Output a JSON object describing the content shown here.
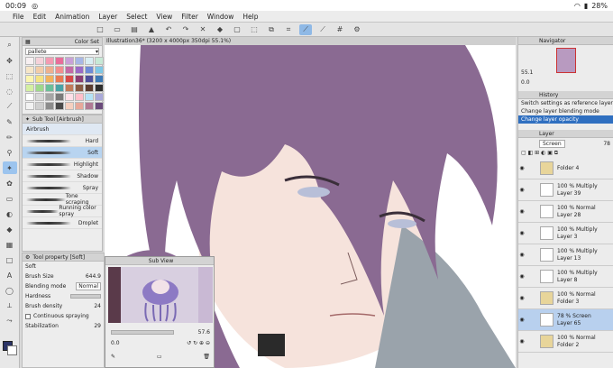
{
  "status": {
    "time": "00:09",
    "battery": "28%"
  },
  "menu": [
    "File",
    "Edit",
    "Animation",
    "Layer",
    "Select",
    "View",
    "Filter",
    "Window",
    "Help"
  ],
  "canvas_title": "Illustration36* (3200 x 4000px 350dpi 55.1%)",
  "color_set": {
    "title": "Color Set",
    "palette": "pallete",
    "colors": [
      "#f7f0f2",
      "#f5d2da",
      "#f39bb2",
      "#e86d9a",
      "#c9a0d8",
      "#a7b7e6",
      "#d8eef3",
      "#c7e9d6",
      "#f6e6c8",
      "#f2cca8",
      "#eeb08e",
      "#f28e8e",
      "#c36aa6",
      "#9a6ac6",
      "#6e8bd6",
      "#7ec7e5",
      "#fbf5b0",
      "#f4e283",
      "#f2b25d",
      "#e97a52",
      "#d64848",
      "#8a3d73",
      "#4e4e9a",
      "#3d79b5",
      "#d4f0a2",
      "#9fd88c",
      "#6bbf9a",
      "#48a3a6",
      "#c27b5a",
      "#8a5a43",
      "#5b3c2f",
      "#2e2e2e",
      "#ffffff",
      "#d9d9d9",
      "#a6a6a6",
      "#7a7a7a",
      "#ffe0e8",
      "#ffc0cb",
      "#b5e3f7",
      "#a9a9d9",
      "#f2f2f2",
      "#cfcfcf",
      "#8c8c8c",
      "#4a4a4a",
      "#f5d0c0",
      "#e7a89a",
      "#b07a94",
      "#6a4a7a"
    ]
  },
  "sub_tool": {
    "title": "Sub Tool [Airbrush]",
    "group": "Airbrush",
    "brushes": [
      "Hard",
      "Soft",
      "Highlight",
      "Shadow",
      "Spray",
      "Tone scraping",
      "Running color spray",
      "Droplet"
    ],
    "selected": "Soft"
  },
  "tool_property": {
    "title": "Tool property [Soft]",
    "name": "Soft",
    "brush_size_label": "Brush Size",
    "brush_size": "644.9",
    "blending_label": "Blending mode",
    "blending": "Normal",
    "hardness_label": "Hardness",
    "density_label": "Brush density",
    "density": "24",
    "continuous_label": "Continuous spraying",
    "stabilization_label": "Stabilization",
    "stabilization": "29"
  },
  "sub_view": {
    "title": "Sub View",
    "zoom": "57.6",
    "rotation": "0.0"
  },
  "navigator": {
    "title": "Navigator",
    "zoom": "55.1",
    "rotation": "0.0"
  },
  "history": {
    "title": "History",
    "items": [
      "Switch settings as reference layer",
      "Change layer blending mode",
      "Change layer opacity"
    ],
    "selected": "Change layer opacity"
  },
  "layer_panel": {
    "title": "Layer",
    "blend": "Screen",
    "opacity": "78",
    "layers": [
      {
        "mode": "",
        "name": "Folder 4",
        "folder": true
      },
      {
        "mode": "100 % Multiply",
        "name": "Layer 39",
        "folder": false
      },
      {
        "mode": "100 % Normal",
        "name": "Layer 28",
        "folder": false
      },
      {
        "mode": "100 % Multiply",
        "name": "Layer 3",
        "folder": false
      },
      {
        "mode": "100 % Multiply",
        "name": "Layer 13",
        "folder": false
      },
      {
        "mode": "100 % Multiply",
        "name": "Layer 8",
        "folder": false
      },
      {
        "mode": "100 % Normal",
        "name": "Folder 3",
        "folder": true
      },
      {
        "mode": "78 % Screen",
        "name": "Layer 65",
        "folder": false,
        "selected": true
      },
      {
        "mode": "100 % Normal",
        "name": "Folder 2",
        "folder": true
      }
    ]
  }
}
